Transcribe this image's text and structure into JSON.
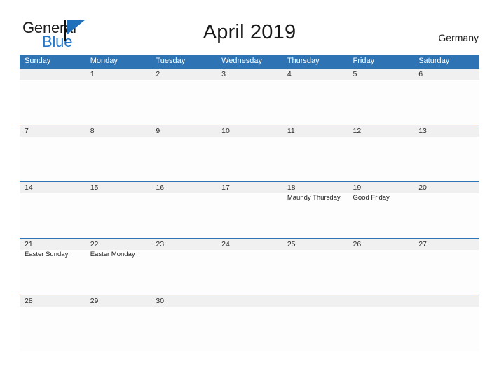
{
  "brand": {
    "name_top": "General",
    "name_bottom": "Blue",
    "flag_icon": "blue-flag-triangle",
    "accent_color": "#2277c8"
  },
  "header": {
    "title": "April 2019",
    "country": "Germany"
  },
  "theme": {
    "header_blue": "#2E74B5",
    "date_band_gray": "#f0f0f0",
    "page_background": "#ffffff",
    "cell_background": "#fdfdfd"
  },
  "calendar": {
    "month": "April",
    "year": "2019",
    "weekday_headers": [
      "Sunday",
      "Monday",
      "Tuesday",
      "Wednesday",
      "Thursday",
      "Friday",
      "Saturday"
    ],
    "weeks": [
      {
        "days": [
          {
            "num": "",
            "event": ""
          },
          {
            "num": "1",
            "event": ""
          },
          {
            "num": "2",
            "event": ""
          },
          {
            "num": "3",
            "event": ""
          },
          {
            "num": "4",
            "event": ""
          },
          {
            "num": "5",
            "event": ""
          },
          {
            "num": "6",
            "event": ""
          }
        ]
      },
      {
        "days": [
          {
            "num": "7",
            "event": ""
          },
          {
            "num": "8",
            "event": ""
          },
          {
            "num": "9",
            "event": ""
          },
          {
            "num": "10",
            "event": ""
          },
          {
            "num": "11",
            "event": ""
          },
          {
            "num": "12",
            "event": ""
          },
          {
            "num": "13",
            "event": ""
          }
        ]
      },
      {
        "days": [
          {
            "num": "14",
            "event": ""
          },
          {
            "num": "15",
            "event": ""
          },
          {
            "num": "16",
            "event": ""
          },
          {
            "num": "17",
            "event": ""
          },
          {
            "num": "18",
            "event": "Maundy Thursday"
          },
          {
            "num": "19",
            "event": "Good Friday"
          },
          {
            "num": "20",
            "event": ""
          }
        ]
      },
      {
        "days": [
          {
            "num": "21",
            "event": "Easter Sunday"
          },
          {
            "num": "22",
            "event": "Easter Monday"
          },
          {
            "num": "23",
            "event": ""
          },
          {
            "num": "24",
            "event": ""
          },
          {
            "num": "25",
            "event": ""
          },
          {
            "num": "26",
            "event": ""
          },
          {
            "num": "27",
            "event": ""
          }
        ]
      },
      {
        "days": [
          {
            "num": "28",
            "event": ""
          },
          {
            "num": "29",
            "event": ""
          },
          {
            "num": "30",
            "event": ""
          },
          {
            "num": "",
            "event": ""
          },
          {
            "num": "",
            "event": ""
          },
          {
            "num": "",
            "event": ""
          },
          {
            "num": "",
            "event": ""
          }
        ]
      }
    ]
  }
}
